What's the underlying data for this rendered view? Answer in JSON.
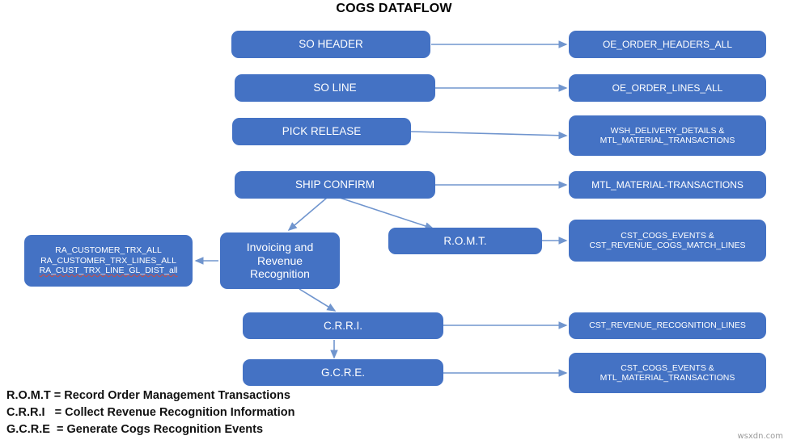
{
  "title": "COGS DATAFLOW",
  "colors": {
    "node_fill": "#4472C4",
    "node_text": "#FFFFFF",
    "arrow": "#7095CE",
    "title_text": "#000000",
    "legend_text": "#111111",
    "spellcheck_underline": "#C0504D",
    "background": "#FFFFFF"
  },
  "nodes": {
    "so_header": {
      "label": "SO HEADER"
    },
    "so_line": {
      "label": "SO LINE"
    },
    "pick_release": {
      "label": "PICK RELEASE"
    },
    "ship_confirm": {
      "label": "SHIP CONFIRM"
    },
    "invoicing": {
      "line1": "Invoicing and",
      "line2": "Revenue",
      "line3": "Recognition"
    },
    "romt": {
      "label": "R.O.M.T."
    },
    "crri": {
      "label": "C.R.R.I."
    },
    "gcre": {
      "label": "G.C.R.E."
    },
    "oe_order_headers_all": {
      "label": "OE_ORDER_HEADERS_ALL"
    },
    "oe_order_lines_all": {
      "label": "OE_ORDER_LINES_ALL"
    },
    "wsh_delivery": {
      "line1": "WSH_DELIVERY_DETAILS &",
      "line2": "MTL_MATERIAL_TRANSACTIONS"
    },
    "mtl_material_transactions": {
      "label": "MTL_MATERIAL-TRANSACTIONS"
    },
    "cst_cogs_events_match": {
      "line1": "CST_COGS_EVENTS &",
      "line2": "CST_REVENUE_COGS_MATCH_LINES"
    },
    "ra_tables": {
      "line1": "RA_CUSTOMER_TRX_ALL",
      "line2": "RA_CUSTOMER_TRX_LINES_ALL",
      "line3": "RA_CUST_TRX_LINE_GL_DIST_all"
    },
    "cst_revenue_recognition_lines": {
      "label": "CST_REVENUE_RECOGNITION_LINES"
    },
    "cst_cogs_events_mtl": {
      "line1": "CST_COGS_EVENTS &",
      "line2": "MTL_MATERIAL_TRANSACTIONS"
    }
  },
  "legend": {
    "line1": "R.O.M.T = Record Order Management Transactions",
    "line2": "C.R.R.I   = Collect Revenue Recognition Information",
    "line3": "G.C.R.E  = Generate Cogs Recognition Events"
  },
  "watermark": "wsxdn.com"
}
